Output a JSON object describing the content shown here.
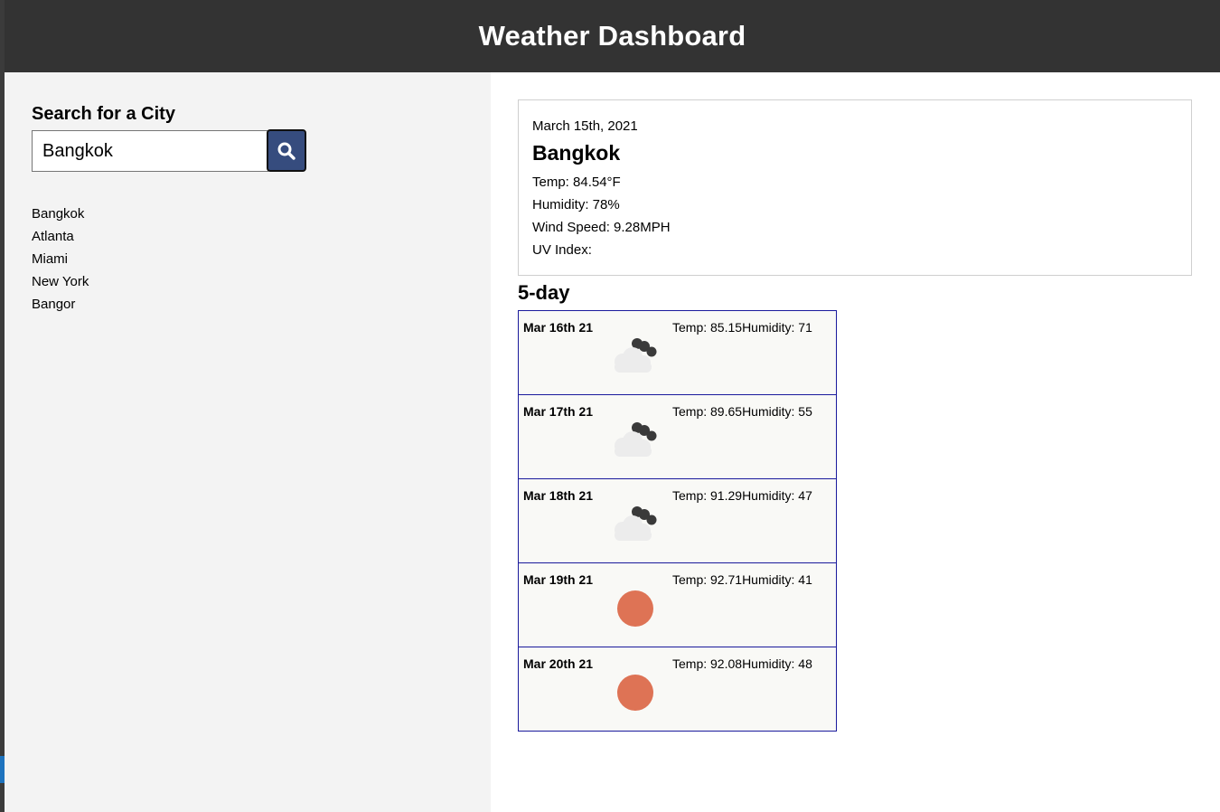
{
  "header": {
    "title": "Weather Dashboard"
  },
  "sidebar": {
    "search_label": "Search for a City",
    "search_value": "Bangkok",
    "search_button_icon": "search-icon",
    "history": [
      "Bangkok",
      "Atlanta",
      "Miami",
      "New York",
      "Bangor"
    ]
  },
  "current": {
    "date": "March 15th, 2021",
    "city": "Bangkok",
    "temp": "Temp: 84.54°F",
    "humidity": "Humidity: 78%",
    "wind": "Wind Speed: 9.28MPH",
    "uv": "UV Index:"
  },
  "forecast": {
    "title": "5-day",
    "days": [
      {
        "date": "Mar 16th 21",
        "icon": "cloudy-night-icon",
        "temp": "Temp: 85.15",
        "humidity": "Humidity: 71"
      },
      {
        "date": "Mar 17th 21",
        "icon": "cloudy-night-icon",
        "temp": "Temp: 89.65",
        "humidity": "Humidity: 55"
      },
      {
        "date": "Mar 18th 21",
        "icon": "cloudy-night-icon",
        "temp": "Temp: 91.29",
        "humidity": "Humidity: 47"
      },
      {
        "date": "Mar 19th 21",
        "icon": "sun-icon",
        "temp": "Temp: 92.71",
        "humidity": "Humidity: 41"
      },
      {
        "date": "Mar 20th 21",
        "icon": "sun-icon",
        "temp": "Temp: 92.08",
        "humidity": "Humidity: 48"
      }
    ]
  },
  "colors": {
    "header_bg": "#333333",
    "sidebar_bg": "#f3f3f3",
    "search_button_bg": "#364c7e",
    "forecast_border": "#1a1a9c",
    "sun": "#de7355"
  }
}
